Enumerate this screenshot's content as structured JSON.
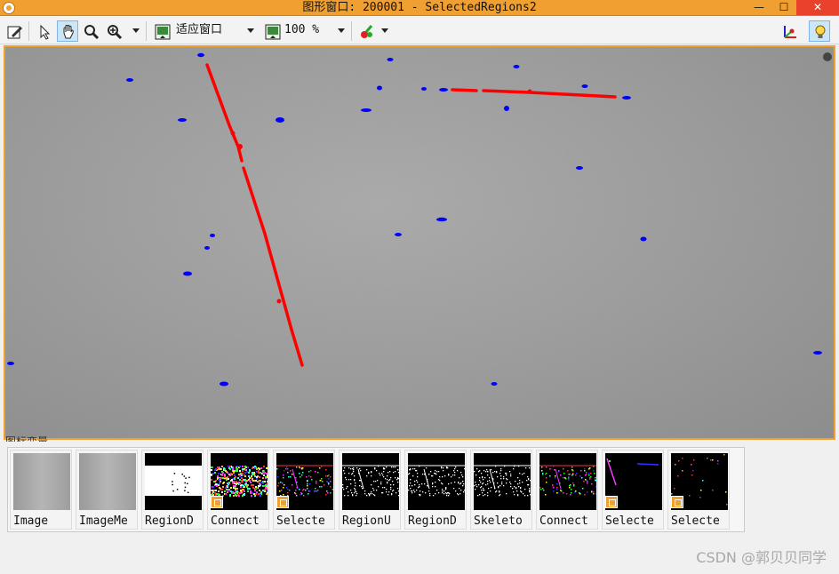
{
  "window": {
    "title": "图形窗口: 200001 - SelectedRegions2",
    "min_label": "—",
    "max_label": "☐",
    "close_label": "✕"
  },
  "toolbar": {
    "fit_label": "适应窗口",
    "zoom_value": "100 %",
    "icons": [
      "edit-icon",
      "pointer-icon",
      "hand-icon",
      "magnifier-icon",
      "zoom-in-icon",
      "fit-window-icon",
      "color-brush-icon",
      "axes-icon",
      "lightbulb-icon"
    ]
  },
  "canvas": {
    "background": "#9f9f9f",
    "defect_color": "#ff0000",
    "blob_color": "#0000ff"
  },
  "panel": {
    "header": "图标变量"
  },
  "thumbnails": [
    {
      "label": "Image",
      "kind": "gray"
    },
    {
      "label": "ImageMe",
      "kind": "gray"
    },
    {
      "label": "RegionD",
      "kind": "region-white"
    },
    {
      "label": "Connect",
      "kind": "noise",
      "badge": true
    },
    {
      "label": "Selecte",
      "kind": "mixed",
      "badge": true
    },
    {
      "label": "RegionU",
      "kind": "speckle"
    },
    {
      "label": "RegionD",
      "kind": "speckle"
    },
    {
      "label": "Skeleto",
      "kind": "speckle"
    },
    {
      "label": "Connect",
      "kind": "mixed"
    },
    {
      "label": "Selecte",
      "kind": "lines",
      "badge": true
    },
    {
      "label": "Selecte",
      "kind": "dots",
      "badge": true
    }
  ],
  "watermark": "CSDN @郭贝贝同学"
}
